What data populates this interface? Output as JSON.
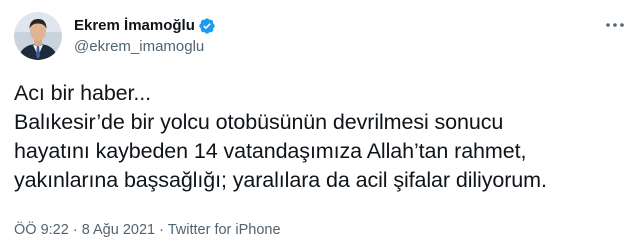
{
  "colors": {
    "text": "#0f1419",
    "secondary": "#536471",
    "verified": "#1d9bf0",
    "background": "#ffffff"
  },
  "author": {
    "display_name": "Ekrem İmamoğlu",
    "handle": "@ekrem_imamoglu",
    "verified_icon": "verified-badge-icon",
    "avatar": "profile-photo"
  },
  "menu": {
    "icon": "more-horizontal-icon"
  },
  "tweet": {
    "lines": [
      "Acı bir haber...",
      "Balıkesir’de bir yolcu otobüsünün devrilmesi sonucu",
      "hayatını kaybeden 14 vatandaşımıza Allah’tan rahmet,",
      "yakınlarına başsağlığı; yaralılara da acil şifalar diliyorum."
    ]
  },
  "meta": {
    "time": "ÖÖ 9:22",
    "separator": " · ",
    "date": "8 Ağu 2021",
    "source": "Twitter for iPhone"
  }
}
